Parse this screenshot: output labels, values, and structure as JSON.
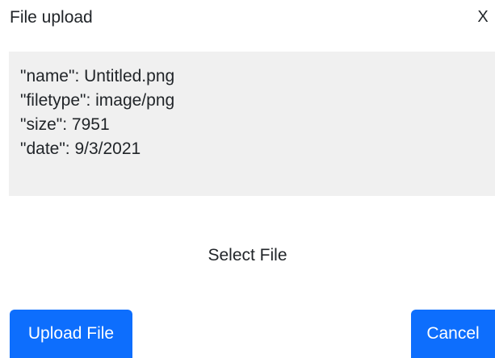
{
  "dialog": {
    "title": "File upload",
    "close_label": "X"
  },
  "file_info": {
    "lines": [
      "\"name\": Untitled.png",
      "\"filetype\": image/png",
      "\"size\": 7951",
      "\"date\": 9/3/2021"
    ]
  },
  "select_file_label": "Select File",
  "buttons": {
    "upload_label": "Upload File",
    "cancel_label": "Cancel"
  },
  "colors": {
    "primary": "#0d6efd",
    "panel_background": "#f0f0f0",
    "text": "#212529"
  }
}
